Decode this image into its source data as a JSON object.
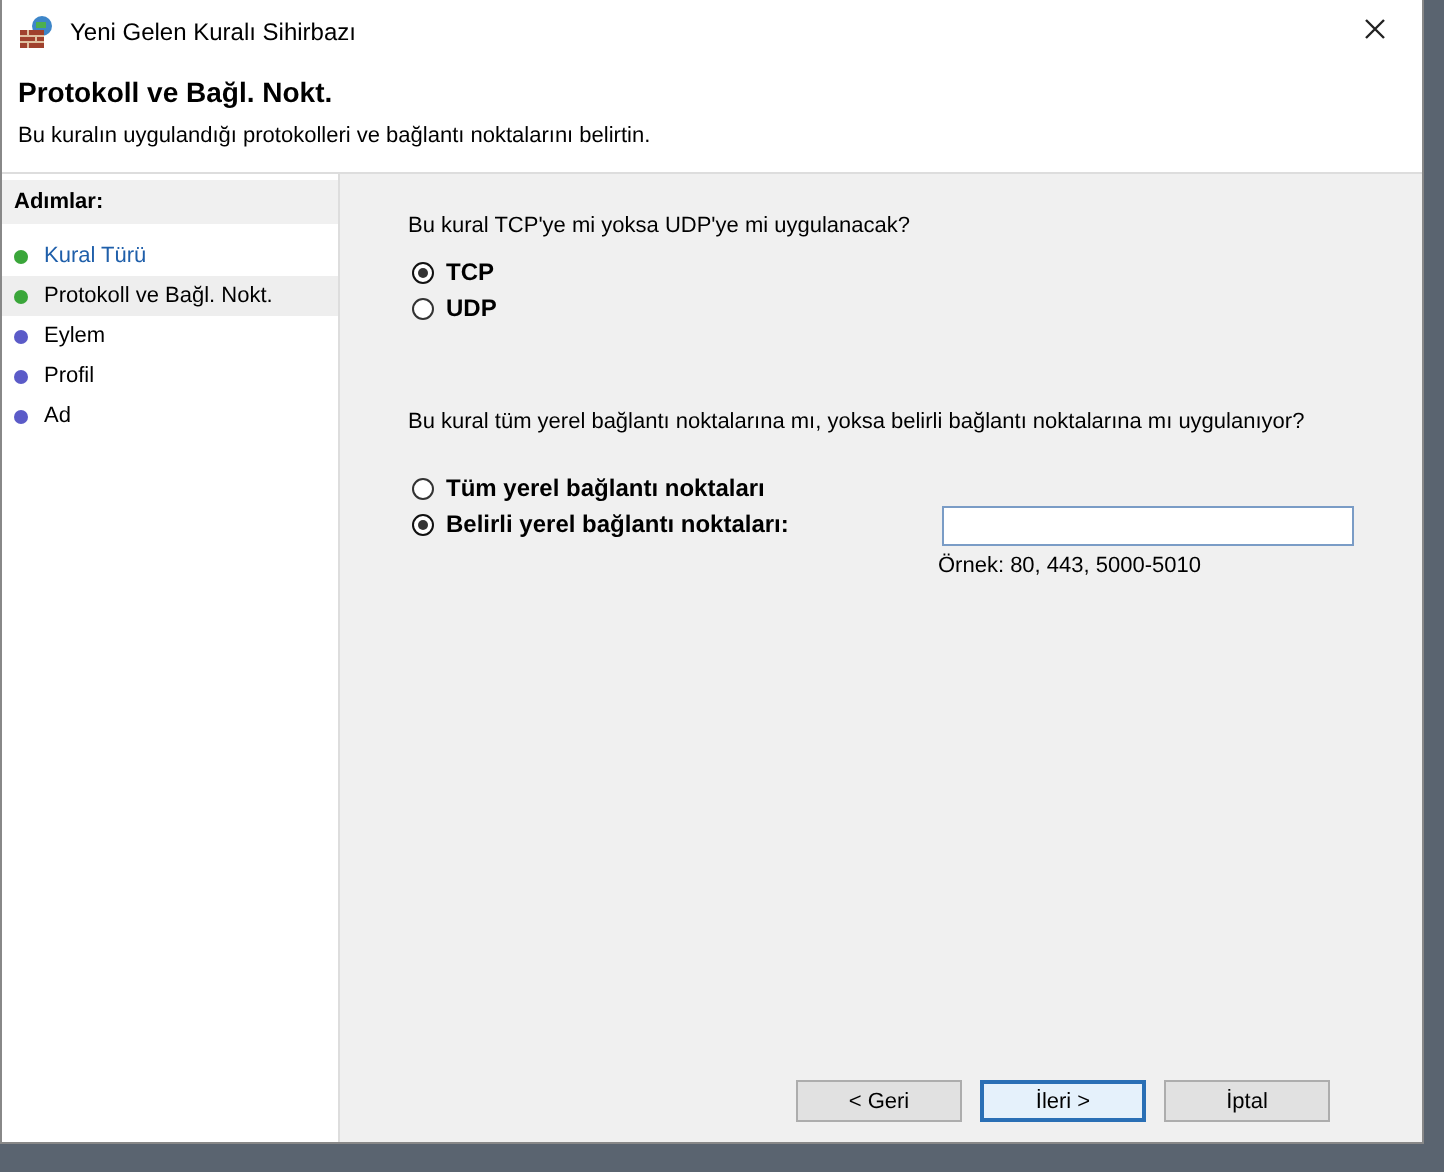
{
  "window": {
    "title": "Yeni Gelen Kuralı Sihirbazı"
  },
  "header": {
    "title": "Protokoll ve Bağl. Nokt.",
    "subtitle": "Bu kuralın uygulandığı protokolleri ve bağlantı noktalarını belirtin."
  },
  "sidebar": {
    "heading": "Adımlar:",
    "items": [
      {
        "label": "Kural Türü",
        "selected": false,
        "link": true,
        "color": "#3aa63a"
      },
      {
        "label": "Protokoll ve Bağl. Nokt.",
        "selected": true,
        "link": false,
        "color": "#3aa63a"
      },
      {
        "label": "Eylem",
        "selected": false,
        "link": false,
        "color": "#5b5bc8"
      },
      {
        "label": "Profil",
        "selected": false,
        "link": false,
        "color": "#5b5bc8"
      },
      {
        "label": "Ad",
        "selected": false,
        "link": false,
        "color": "#5b5bc8"
      }
    ]
  },
  "protocol": {
    "question": "Bu kural TCP'ye mi yoksa UDP'ye mi uygulanacak?",
    "options": [
      {
        "label": "TCP",
        "selected": true
      },
      {
        "label": "UDP",
        "selected": false
      }
    ]
  },
  "ports": {
    "question": "Bu kural tüm yerel bağlantı noktalarına mı, yoksa belirli bağlantı noktalarına mı uygulanıyor?",
    "options": [
      {
        "label": "Tüm yerel bağlantı noktaları",
        "selected": false
      },
      {
        "label": "Belirli yerel bağlantı noktaları:",
        "selected": true
      }
    ],
    "hint": "Örnek: 80, 443, 5000-5010"
  },
  "buttons": [
    {
      "label": "< Geri",
      "default": false
    },
    {
      "label": "İleri >",
      "default": true
    },
    {
      "label": "İptal",
      "default": false
    }
  ]
}
